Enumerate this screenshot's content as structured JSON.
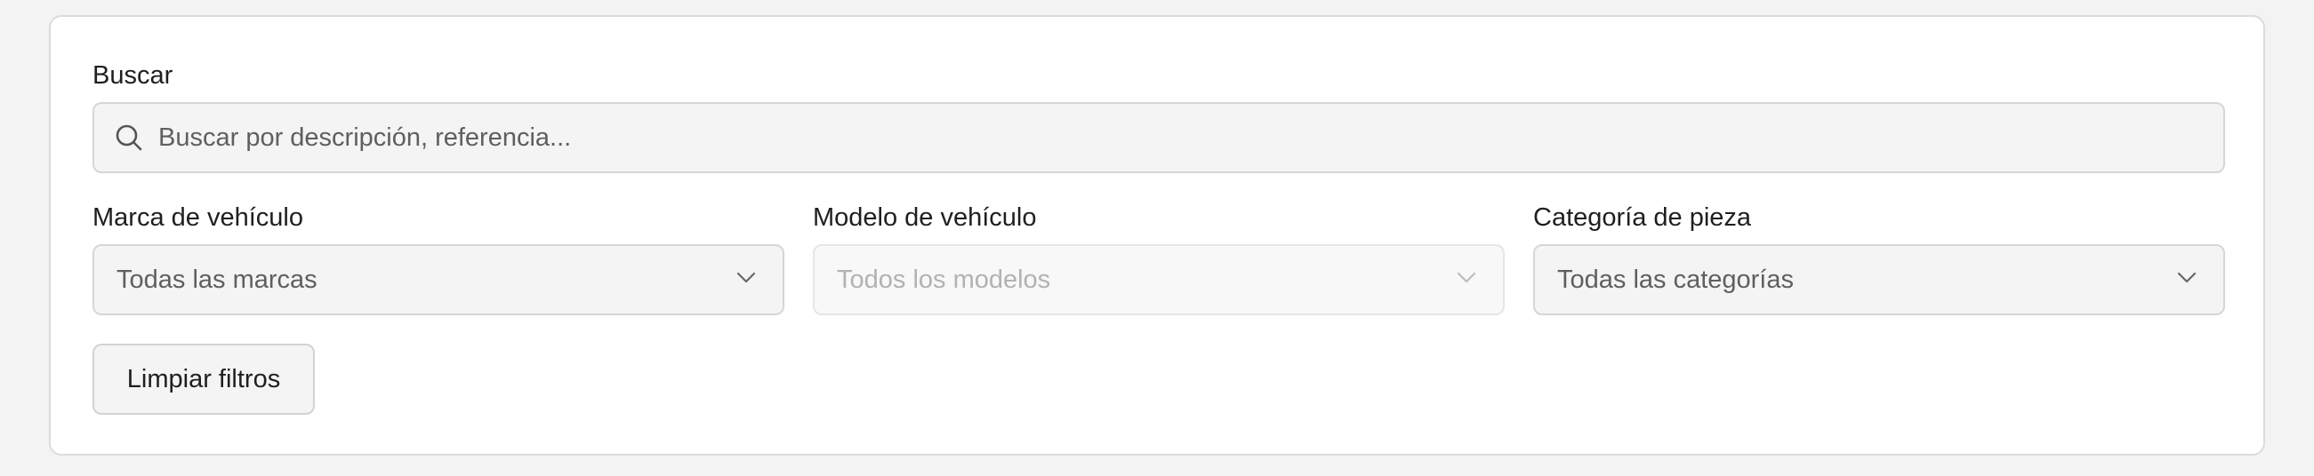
{
  "search": {
    "label": "Buscar",
    "placeholder": "Buscar por descripción, referencia..."
  },
  "filters": {
    "brand": {
      "label": "Marca de vehículo",
      "selected": "Todas las marcas",
      "disabled": false
    },
    "model": {
      "label": "Modelo de vehículo",
      "selected": "Todos los modelos",
      "disabled": true
    },
    "category": {
      "label": "Categoría de pieza",
      "selected": "Todas las categorías",
      "disabled": false
    }
  },
  "actions": {
    "clear_label": "Limpiar filtros"
  },
  "icons": {
    "search": "search-icon",
    "select_arrow": "chevron-down-icon"
  },
  "colors": {
    "page_background": "#f3f3f3",
    "card_background": "#ffffff",
    "input_background": "#f4f4f4",
    "border": "#d6d6d6",
    "text": "#1f1f1f",
    "muted_text": "#5f5f5f",
    "disabled_text": "#b2b2b2"
  }
}
